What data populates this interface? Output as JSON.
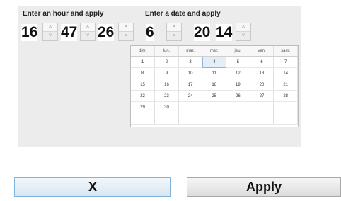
{
  "time_section": {
    "label": "Enter an hour and apply",
    "hour": "16",
    "minute": "47",
    "second": "26"
  },
  "date_section": {
    "label": "Enter a date and apply",
    "day": "6",
    "year_prefix": "20",
    "year_suffix": "14"
  },
  "spinner": {
    "up": "˄",
    "down": "˅"
  },
  "calendar": {
    "weekdays": [
      "dim.",
      "lun.",
      "mar.",
      "mer.",
      "jeu.",
      "ven.",
      "sam."
    ],
    "weeks": [
      [
        "1",
        "2",
        "3",
        "4",
        "5",
        "6",
        "7"
      ],
      [
        "8",
        "9",
        "10",
        "11",
        "12",
        "13",
        "14"
      ],
      [
        "15",
        "16",
        "17",
        "18",
        "19",
        "20",
        "21"
      ],
      [
        "22",
        "23",
        "24",
        "25",
        "26",
        "27",
        "28"
      ],
      [
        "29",
        "30",
        "",
        "",
        "",
        "",
        ""
      ],
      [
        "",
        "",
        "",
        "",
        "",
        "",
        ""
      ]
    ],
    "selected_day": "4"
  },
  "buttons": {
    "cancel_label": "X",
    "apply_label": "Apply"
  }
}
